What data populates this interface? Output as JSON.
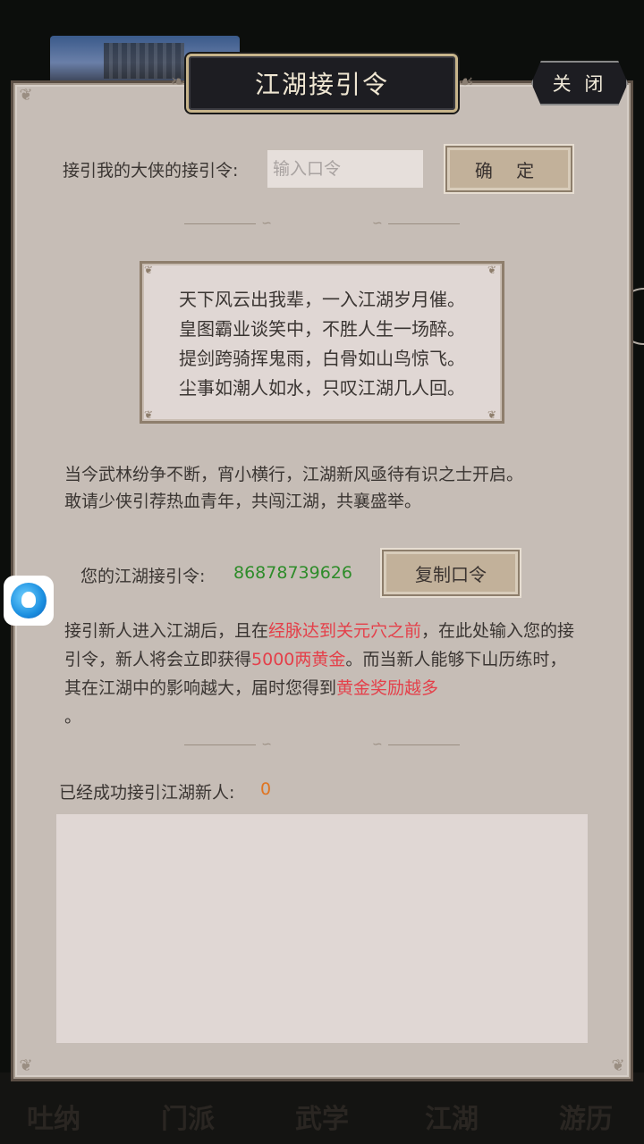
{
  "background": {
    "nav_items": [
      "吐纳",
      "门派",
      "武学",
      "江湖",
      "游历"
    ]
  },
  "dialog": {
    "title": "江湖接引令",
    "close_label": "关 闭",
    "invite_label": "接引我的大侠的接引令:",
    "invite_input_placeholder": "输入口令",
    "invite_input_value": "",
    "confirm_label": "确 定",
    "poem": [
      "天下风云出我辈，一入江湖岁月催。",
      "皇图霸业谈笑中，不胜人生一场醉。",
      "提剑跨骑挥鬼雨，白骨如山鸟惊飞。",
      "尘事如潮人如水，只叹江湖几人回。"
    ],
    "description": [
      "当今武林纷争不断，宵小横行，江湖新风亟待有识之士开启。",
      "敢请少侠引荐热血青年，共闯江湖，共襄盛举。"
    ],
    "your_code_label": "您的江湖接引令:",
    "your_code_value": "86878739626",
    "copy_label": "复制口令",
    "rule": {
      "p1": "接引新人进入江湖后，且在",
      "h1": "经脉达到关元穴之前",
      "p2": "，在此处输入您的接引令，新人将会立即获得",
      "h2": "5000两黄金",
      "p3": "。而当新人能够下山历练时，其在江湖中的影响越大，届时您得到",
      "h3": "黄金奖励越多",
      "p4": "。"
    },
    "success_label": "已经成功接引江湖新人:",
    "success_count": "0"
  },
  "colors": {
    "panel_bg": "#c6bdb6",
    "title_plate": "#1d1d22",
    "highlight_red": "#e4404a",
    "code_green": "#2e8c2a",
    "count_orange": "#e07420"
  },
  "icons": {
    "float_button": "assistant-logo-icon",
    "side_tab": "side-arrow-icon"
  }
}
